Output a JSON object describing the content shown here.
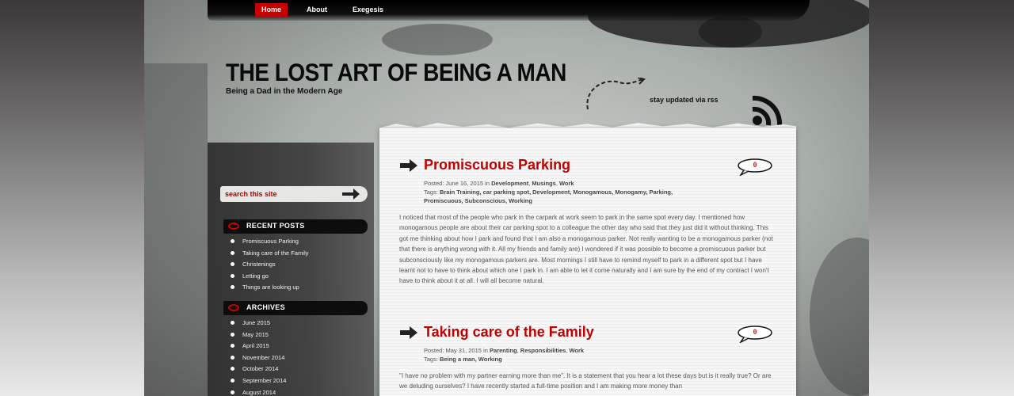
{
  "nav": {
    "items": [
      "Home",
      "About",
      "Exegesis"
    ]
  },
  "header": {
    "title": "THE LOST ART OF BEING A MAN",
    "tagline": "Being a Dad in the Modern Age",
    "rss_label": "stay updated via rss"
  },
  "sidebar": {
    "search_placeholder": "search this site",
    "recent_title": "RECENT POSTS",
    "recent": [
      "Promiscuous Parking",
      "Taking care of the Family",
      "Christenings",
      "Letting go",
      "Things are looking up"
    ],
    "archives_title": "ARCHIVES",
    "archives": [
      "June 2015",
      "May 2015",
      "April 2015",
      "November 2014",
      "October 2014",
      "September 2014",
      "August 2014"
    ]
  },
  "posts": [
    {
      "title": "Promiscuous Parking",
      "comments": "0",
      "posted_label": "Posted:",
      "date": "June 16, 2015",
      "in": "in",
      "categories": [
        "Development",
        "Musings",
        "Work"
      ],
      "tags_label": "Tags:",
      "tags_line1": "Brain Training, car parking spot, Development, Monogamous, Monogamy, Parking,",
      "tags_line2": "Promiscuous, Subconscious, Working",
      "excerpt": "I noticed that most of the people who park in the carpark at work seem to park in the same spot every day. I mentioned how monogamous people are about their car parking spot to a colleague the other day who said that they just did it without thinking. This got me thinking about how I park and found that I am also a monogamous parker. Not really wanting to be a monogamous parker (not that there is anything wrong with it. All my friends and family are) I wondered if it was possible to become a promiscuous parker but subconsciously like my monogamous parkers are. Most mornings I still have to remind myself to park in a different spot but I have learnt not to have to think about which one I park in. I am able to let it come naturally and I am sure by the end of my contract I won't have to think about it at all. I will all become natural."
    },
    {
      "title": "Taking care of the Family",
      "comments": "0",
      "posted_label": "Posted:",
      "date": "May 31, 2015",
      "in": "in",
      "categories": [
        "Parenting",
        "Responsibilities",
        "Work"
      ],
      "tags_label": "Tags:",
      "tags_line1": "Being a man, Working",
      "excerpt": "\"I have no problem with my partner earning more than me\". It is a statement that you hear a lot these days but is it really true? Or are we deluding ourselves? I have recently started a full-time position and I am making more money than"
    }
  ],
  "colors": {
    "accent": "#c80000",
    "title_red": "#c00000",
    "paper": "#f7f7f7"
  }
}
